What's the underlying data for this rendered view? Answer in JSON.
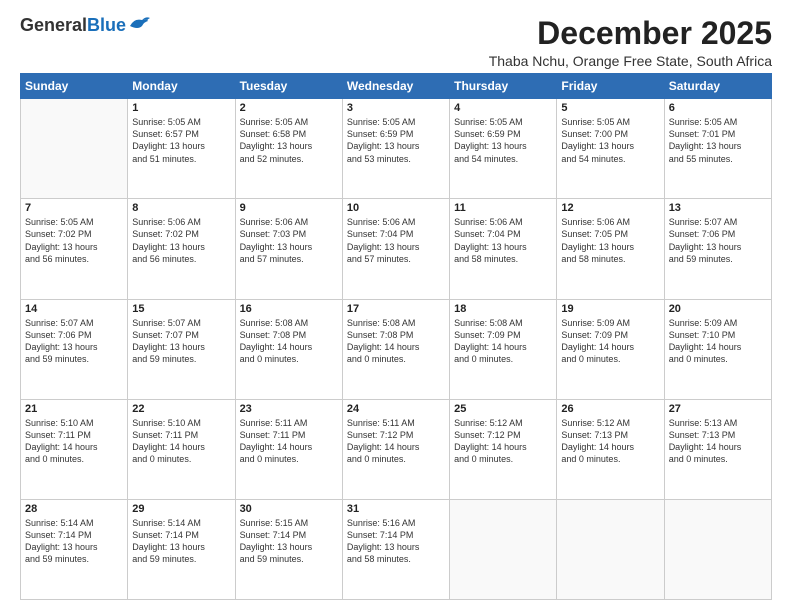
{
  "logo": {
    "general": "General",
    "blue": "Blue"
  },
  "title": "December 2025",
  "subtitle": "Thaba Nchu, Orange Free State, South Africa",
  "header_days": [
    "Sunday",
    "Monday",
    "Tuesday",
    "Wednesday",
    "Thursday",
    "Friday",
    "Saturday"
  ],
  "weeks": [
    [
      {
        "day": "",
        "text": ""
      },
      {
        "day": "1",
        "text": "Sunrise: 5:05 AM\nSunset: 6:57 PM\nDaylight: 13 hours\nand 51 minutes."
      },
      {
        "day": "2",
        "text": "Sunrise: 5:05 AM\nSunset: 6:58 PM\nDaylight: 13 hours\nand 52 minutes."
      },
      {
        "day": "3",
        "text": "Sunrise: 5:05 AM\nSunset: 6:59 PM\nDaylight: 13 hours\nand 53 minutes."
      },
      {
        "day": "4",
        "text": "Sunrise: 5:05 AM\nSunset: 6:59 PM\nDaylight: 13 hours\nand 54 minutes."
      },
      {
        "day": "5",
        "text": "Sunrise: 5:05 AM\nSunset: 7:00 PM\nDaylight: 13 hours\nand 54 minutes."
      },
      {
        "day": "6",
        "text": "Sunrise: 5:05 AM\nSunset: 7:01 PM\nDaylight: 13 hours\nand 55 minutes."
      }
    ],
    [
      {
        "day": "7",
        "text": "Sunrise: 5:05 AM\nSunset: 7:02 PM\nDaylight: 13 hours\nand 56 minutes."
      },
      {
        "day": "8",
        "text": "Sunrise: 5:06 AM\nSunset: 7:02 PM\nDaylight: 13 hours\nand 56 minutes."
      },
      {
        "day": "9",
        "text": "Sunrise: 5:06 AM\nSunset: 7:03 PM\nDaylight: 13 hours\nand 57 minutes."
      },
      {
        "day": "10",
        "text": "Sunrise: 5:06 AM\nSunset: 7:04 PM\nDaylight: 13 hours\nand 57 minutes."
      },
      {
        "day": "11",
        "text": "Sunrise: 5:06 AM\nSunset: 7:04 PM\nDaylight: 13 hours\nand 58 minutes."
      },
      {
        "day": "12",
        "text": "Sunrise: 5:06 AM\nSunset: 7:05 PM\nDaylight: 13 hours\nand 58 minutes."
      },
      {
        "day": "13",
        "text": "Sunrise: 5:07 AM\nSunset: 7:06 PM\nDaylight: 13 hours\nand 59 minutes."
      }
    ],
    [
      {
        "day": "14",
        "text": "Sunrise: 5:07 AM\nSunset: 7:06 PM\nDaylight: 13 hours\nand 59 minutes."
      },
      {
        "day": "15",
        "text": "Sunrise: 5:07 AM\nSunset: 7:07 PM\nDaylight: 13 hours\nand 59 minutes."
      },
      {
        "day": "16",
        "text": "Sunrise: 5:08 AM\nSunset: 7:08 PM\nDaylight: 14 hours\nand 0 minutes."
      },
      {
        "day": "17",
        "text": "Sunrise: 5:08 AM\nSunset: 7:08 PM\nDaylight: 14 hours\nand 0 minutes."
      },
      {
        "day": "18",
        "text": "Sunrise: 5:08 AM\nSunset: 7:09 PM\nDaylight: 14 hours\nand 0 minutes."
      },
      {
        "day": "19",
        "text": "Sunrise: 5:09 AM\nSunset: 7:09 PM\nDaylight: 14 hours\nand 0 minutes."
      },
      {
        "day": "20",
        "text": "Sunrise: 5:09 AM\nSunset: 7:10 PM\nDaylight: 14 hours\nand 0 minutes."
      }
    ],
    [
      {
        "day": "21",
        "text": "Sunrise: 5:10 AM\nSunset: 7:11 PM\nDaylight: 14 hours\nand 0 minutes."
      },
      {
        "day": "22",
        "text": "Sunrise: 5:10 AM\nSunset: 7:11 PM\nDaylight: 14 hours\nand 0 minutes."
      },
      {
        "day": "23",
        "text": "Sunrise: 5:11 AM\nSunset: 7:11 PM\nDaylight: 14 hours\nand 0 minutes."
      },
      {
        "day": "24",
        "text": "Sunrise: 5:11 AM\nSunset: 7:12 PM\nDaylight: 14 hours\nand 0 minutes."
      },
      {
        "day": "25",
        "text": "Sunrise: 5:12 AM\nSunset: 7:12 PM\nDaylight: 14 hours\nand 0 minutes."
      },
      {
        "day": "26",
        "text": "Sunrise: 5:12 AM\nSunset: 7:13 PM\nDaylight: 14 hours\nand 0 minutes."
      },
      {
        "day": "27",
        "text": "Sunrise: 5:13 AM\nSunset: 7:13 PM\nDaylight: 14 hours\nand 0 minutes."
      }
    ],
    [
      {
        "day": "28",
        "text": "Sunrise: 5:14 AM\nSunset: 7:14 PM\nDaylight: 13 hours\nand 59 minutes."
      },
      {
        "day": "29",
        "text": "Sunrise: 5:14 AM\nSunset: 7:14 PM\nDaylight: 13 hours\nand 59 minutes."
      },
      {
        "day": "30",
        "text": "Sunrise: 5:15 AM\nSunset: 7:14 PM\nDaylight: 13 hours\nand 59 minutes."
      },
      {
        "day": "31",
        "text": "Sunrise: 5:16 AM\nSunset: 7:14 PM\nDaylight: 13 hours\nand 58 minutes."
      },
      {
        "day": "",
        "text": ""
      },
      {
        "day": "",
        "text": ""
      },
      {
        "day": "",
        "text": ""
      }
    ]
  ]
}
